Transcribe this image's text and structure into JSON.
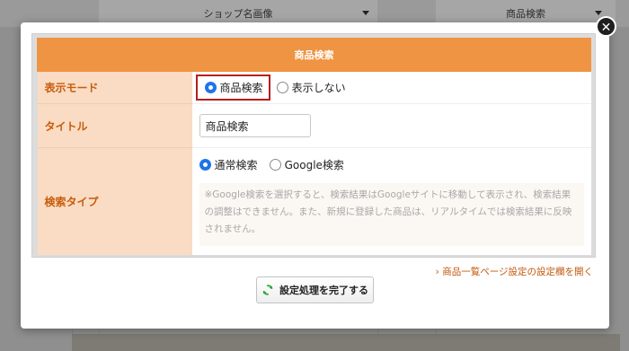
{
  "background": {
    "col1_label": "ショップ名画像",
    "col2_label": "商品検索"
  },
  "modal": {
    "close_label": "✕",
    "header_title": "商品検索",
    "rows": {
      "display_mode": {
        "label": "表示モード",
        "options": [
          "商品検索",
          "表示しない"
        ],
        "selected": "商品検索"
      },
      "title": {
        "label": "タイトル",
        "value": "商品検索"
      },
      "search_type": {
        "label": "検索タイプ",
        "options": [
          "通常検索",
          "Google検索"
        ],
        "selected": "通常検索",
        "note": "※Google検索を選択すると、検索結果はGoogleサイトに移動して表示され、検索結果の調整はできません。また、新規に登録した商品は、リアルタイムでは検索結果に反映されません。"
      }
    },
    "settings_link": "商品一覧ページ設定の設定欄を開く",
    "link_prefix": "›",
    "submit_label": "設定処理を完了する"
  },
  "colors": {
    "header_orange": "#ef9442",
    "label_bg": "#f9dcc3",
    "label_text": "#c85c0c",
    "radio_selected": "#1e74e8",
    "highlight_border": "#b91c1c",
    "link": "#c2570a",
    "refresh_icon": "#2fa536"
  },
  "icons": {
    "close": "close-icon",
    "dropdown": "triangle-down-icon",
    "refresh": "refresh-icon"
  }
}
